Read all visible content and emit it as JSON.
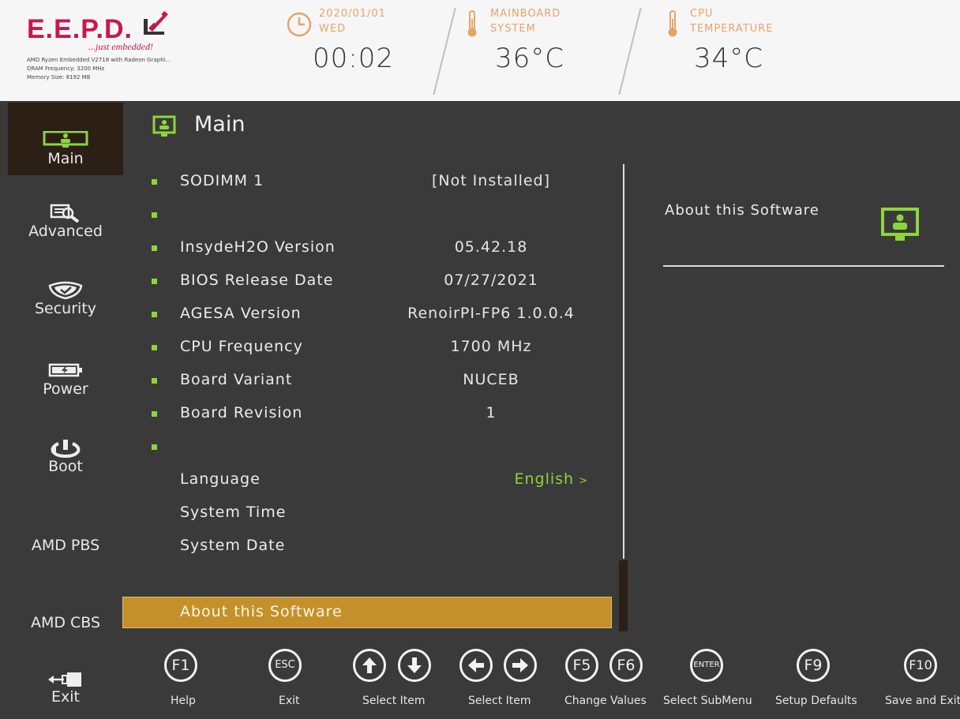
{
  "header": {
    "logo": "E.E.P.D.",
    "tagline": "...just embedded!",
    "sysinfo": [
      "AMD Ryzen Embedded V2718 with Radeon Graphi...",
      "DRAM Frequency: 3200 MHz",
      "Memory Size: 8192 MB"
    ],
    "date": "2020/01/01",
    "weekday": "WED",
    "time": "00:02",
    "mb_label_1": "MAINBOARD",
    "mb_label_2": "SYSTEM",
    "mb_temp": "36°C",
    "cpu_label_1": "CPU",
    "cpu_label_2": "TEMPERATURE",
    "cpu_temp": "34°C",
    "accent_color": "#e2a66b",
    "logo_color": "#c8174e"
  },
  "sidebar": {
    "items": [
      {
        "label": "Main",
        "icon": "monitor-icon"
      },
      {
        "label": "Advanced",
        "icon": "magnifier-icon"
      },
      {
        "label": "Security",
        "icon": "shield-icon"
      },
      {
        "label": "Power",
        "icon": "battery-icon"
      },
      {
        "label": "Boot",
        "icon": "power-icon"
      },
      {
        "label": "AMD PBS",
        "icon": ""
      },
      {
        "label": "AMD CBS",
        "icon": ""
      },
      {
        "label": "Exit",
        "icon": "exit-icon"
      }
    ]
  },
  "main": {
    "title": "Main",
    "rows": [
      {
        "label": "SODIMM 1",
        "value": "[Not Installed]"
      },
      {
        "label": "",
        "value": ""
      },
      {
        "label": "InsydeH2O Version",
        "value": "05.42.18"
      },
      {
        "label": "BIOS Release Date",
        "value": "07/27/2021"
      },
      {
        "label": "AGESA Version",
        "value": "RenoirPI-FP6 1.0.0.4"
      },
      {
        "label": "CPU Frequency",
        "value": "1700 MHz"
      },
      {
        "label": "Board Variant",
        "value": "NUCEB"
      },
      {
        "label": "Board Revision",
        "value": "1"
      },
      {
        "label": "",
        "value": ""
      }
    ],
    "language_label": "Language",
    "language_value": "English",
    "language_chevron": ">",
    "system_time": "System Time",
    "system_date": "System Date",
    "about": "About this Software"
  },
  "help": {
    "title": "About this Software"
  },
  "footer": {
    "keys": [
      {
        "key": "F1",
        "label": "Help"
      },
      {
        "key": "ESC",
        "label": "Exit"
      },
      {
        "key": "up/down",
        "label": "Select Item"
      },
      {
        "key": "left/right",
        "label": "Select Item"
      },
      {
        "key": "F5F6",
        "label": "Change Values",
        "k1": "F5",
        "k2": "F6"
      },
      {
        "key": "ENTER",
        "label": "Select  SubMenu"
      },
      {
        "key": "F9",
        "label": "Setup Defaults"
      },
      {
        "key": "F10",
        "label": "Save and Exit"
      }
    ]
  }
}
